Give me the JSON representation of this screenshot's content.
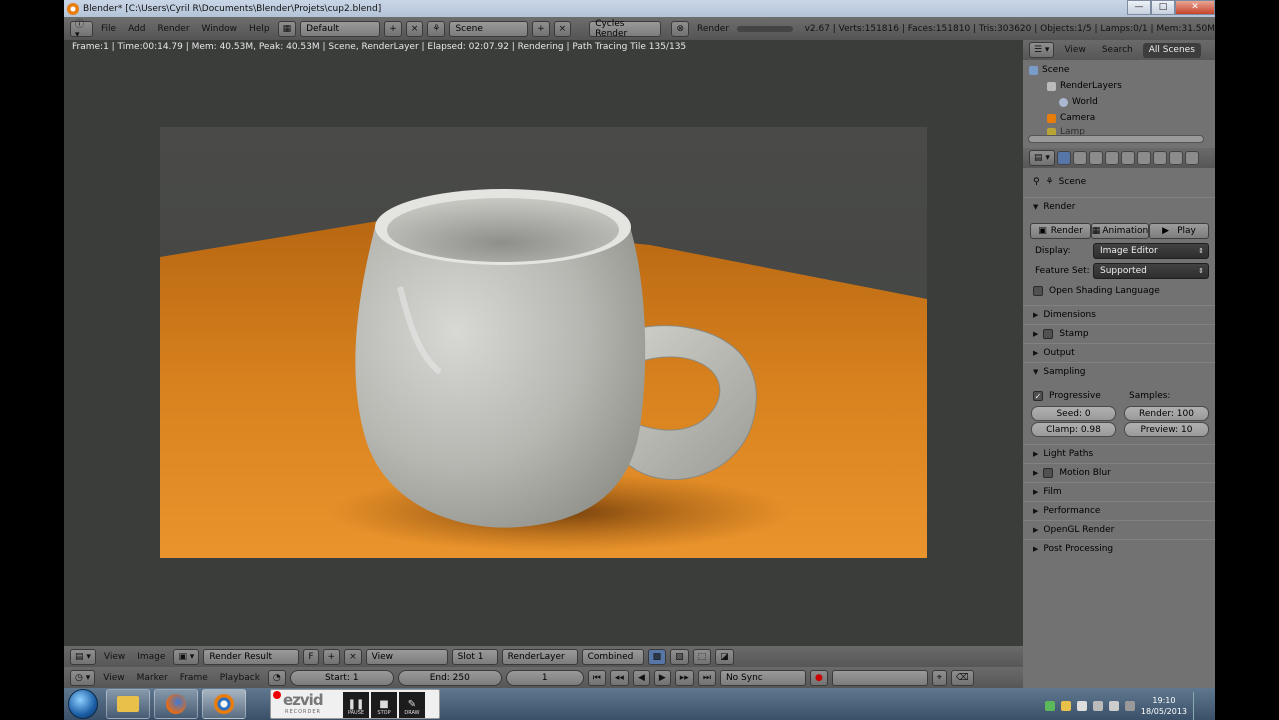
{
  "window": {
    "title": "Blender* [C:\\Users\\Cyril R\\Documents\\Blender\\Projets\\cup2.blend]",
    "minimize": "—",
    "maximize": "□",
    "close": "✕"
  },
  "info_header": {
    "menus": [
      "File",
      "Add",
      "Render",
      "Window",
      "Help"
    ],
    "layout": "Default",
    "scene": "Scene",
    "engine": "Cycles Render",
    "render_label": "Render",
    "stats": "v2.67 | Verts:151816 | Faces:151810 | Tris:303620 | Objects:1/5 | Lamps:0/1 | Mem:31.50M"
  },
  "viewport": {
    "status": "Frame:1 | Time:00:14.79 | Mem: 40.53M, Peak: 40.53M | Scene, RenderLayer | Elapsed: 02:07.92 | Rendering | Path Tracing Tile 135/135"
  },
  "image_editor": {
    "menus": [
      "View",
      "Image"
    ],
    "image": "Render Result",
    "fake_user": "F",
    "view_mode": "View",
    "slot": "Slot 1",
    "layer": "RenderLayer",
    "pass": "Combined"
  },
  "timeline": {
    "menus": [
      "View",
      "Marker",
      "Frame",
      "Playback"
    ],
    "start": "Start: 1",
    "end": "End: 250",
    "current": "1",
    "sync": "No Sync"
  },
  "outliner": {
    "tabs": [
      "View",
      "Search",
      "All Scenes"
    ],
    "items": [
      "Scene",
      "RenderLayers",
      "World",
      "Camera",
      "Lamp"
    ]
  },
  "properties": {
    "context": "Scene",
    "render_panel": "Render",
    "render_buttons": [
      "Render",
      "Animation",
      "Play"
    ],
    "display_label": "Display:",
    "display_value": "Image Editor",
    "feature_label": "Feature Set:",
    "feature_value": "Supported",
    "osl_label": "Open Shading Language",
    "panels_top": [
      "Dimensions",
      "Stamp",
      "Output"
    ],
    "sampling": {
      "title": "Sampling",
      "progressive": "Progressive",
      "samples_label": "Samples:",
      "seed": "Seed: 0",
      "clamp": "Clamp: 0.98",
      "render": "Render: 100",
      "preview": "Preview: 10"
    },
    "panels_bottom": [
      "Light Paths",
      "Motion Blur",
      "Film",
      "Performance",
      "OpenGL Render",
      "Post Processing"
    ]
  },
  "taskbar": {
    "ezvid_logo": "ezvid",
    "ezvid_sub": "RECORDER",
    "controls": [
      "PAUSE",
      "STOP",
      "DRAW"
    ],
    "time": "19:10",
    "date": "18/05/2013"
  }
}
